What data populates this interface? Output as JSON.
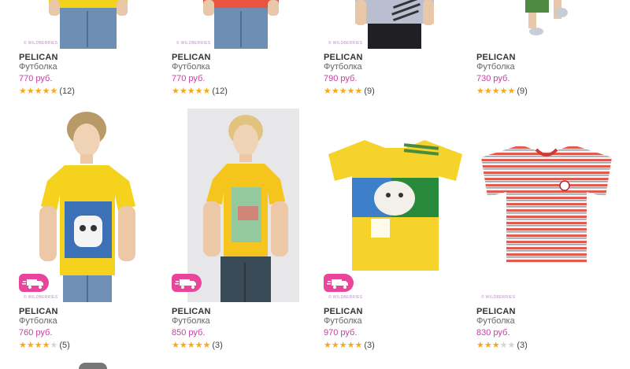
{
  "watermark": "© WILDBERRIES",
  "accent_price_color": "#c63ea2",
  "star_color": "#f7a81b",
  "products": [
    {
      "brand": "PELICAN",
      "type": "Футболка",
      "price": "770 руб.",
      "stars": 5,
      "reviews": "(12)",
      "icon": "tshirt-photo-top-1"
    },
    {
      "brand": "PELICAN",
      "type": "Футболка",
      "price": "770 руб.",
      "stars": 5,
      "reviews": "(12)",
      "icon": "tshirt-photo-top-2"
    },
    {
      "brand": "PELICAN",
      "type": "Футболка",
      "price": "790 руб.",
      "stars": 5,
      "reviews": "(9)",
      "icon": "tshirt-photo-top-3"
    },
    {
      "brand": "PELICAN",
      "type": "Футболка",
      "price": "730 руб.",
      "stars": 5,
      "reviews": "(9)",
      "icon": "tshirt-photo-top-4"
    },
    {
      "brand": "PELICAN",
      "type": "Футболка",
      "price": "760 руб.",
      "stars": 4,
      "reviews": "(5)",
      "icon": "tshirt-photo-yellow-bulldog",
      "delivery_badge": true
    },
    {
      "brand": "PELICAN",
      "type": "Футболка",
      "price": "850 руб.",
      "stars": 5,
      "reviews": "(3)",
      "icon": "tshirt-photo-yellow-fearless",
      "delivery_badge": true
    },
    {
      "brand": "PELICAN",
      "type": "Футболка",
      "price": "970 руб.",
      "stars": 5,
      "reviews": "(3)",
      "icon": "tshirt-photo-yellow-tiger",
      "delivery_badge": true
    },
    {
      "brand": "PELICAN",
      "type": "Футболка",
      "price": "830 руб.",
      "stars": 3,
      "reviews": "(3)",
      "icon": "tshirt-photo-striped",
      "delivery_badge": false
    }
  ]
}
